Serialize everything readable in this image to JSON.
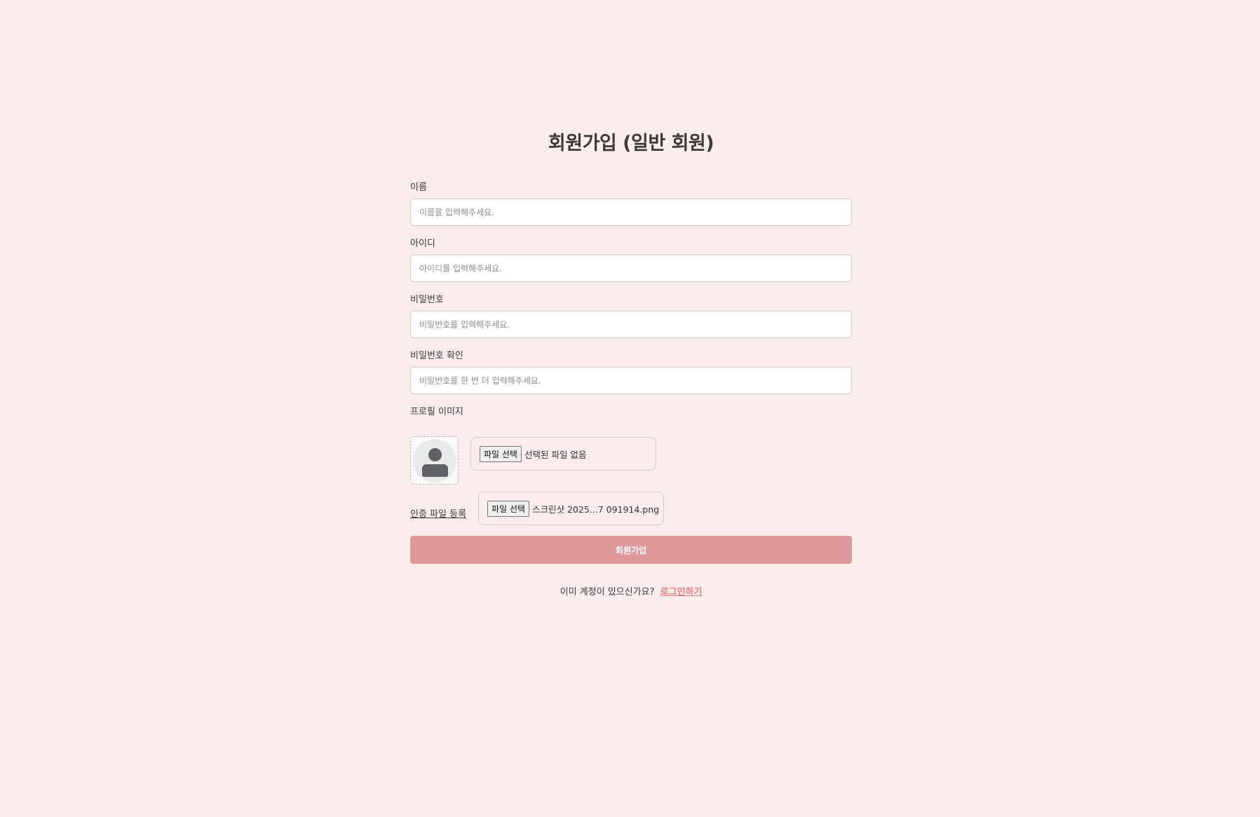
{
  "page": {
    "title": "회원가입 (일반 회원)"
  },
  "fields": {
    "name": {
      "label": "이름",
      "placeholder": "이름을 입력해주세요.",
      "value": ""
    },
    "userid": {
      "label": "아이디",
      "placeholder": "아이디를 입력해주세요.",
      "value": ""
    },
    "password": {
      "label": "비밀번호",
      "placeholder": "비밀번호를 입력해주세요.",
      "value": ""
    },
    "password_confirm": {
      "label": "비밀번호 확인",
      "placeholder": "비밀번호를 한 번 더 입력해주세요.",
      "value": ""
    }
  },
  "profile": {
    "label": "프로필 이미지",
    "avatar_icon": "user-avatar-icon",
    "file_button": "파일 선택",
    "file_name": "선택된 파일 없음"
  },
  "certificate": {
    "link_label": "인증 파일 등록",
    "file_button": "파일 선택",
    "file_name": "스크린샷 2025...7 091914.png"
  },
  "submit": {
    "label": "회원가입"
  },
  "footer": {
    "prompt": "이미 계정이 있으신가요?",
    "login_link": "로그인하기"
  },
  "colors": {
    "background": "#fcedec",
    "submit": "#df999b",
    "link": "#e07d84"
  }
}
